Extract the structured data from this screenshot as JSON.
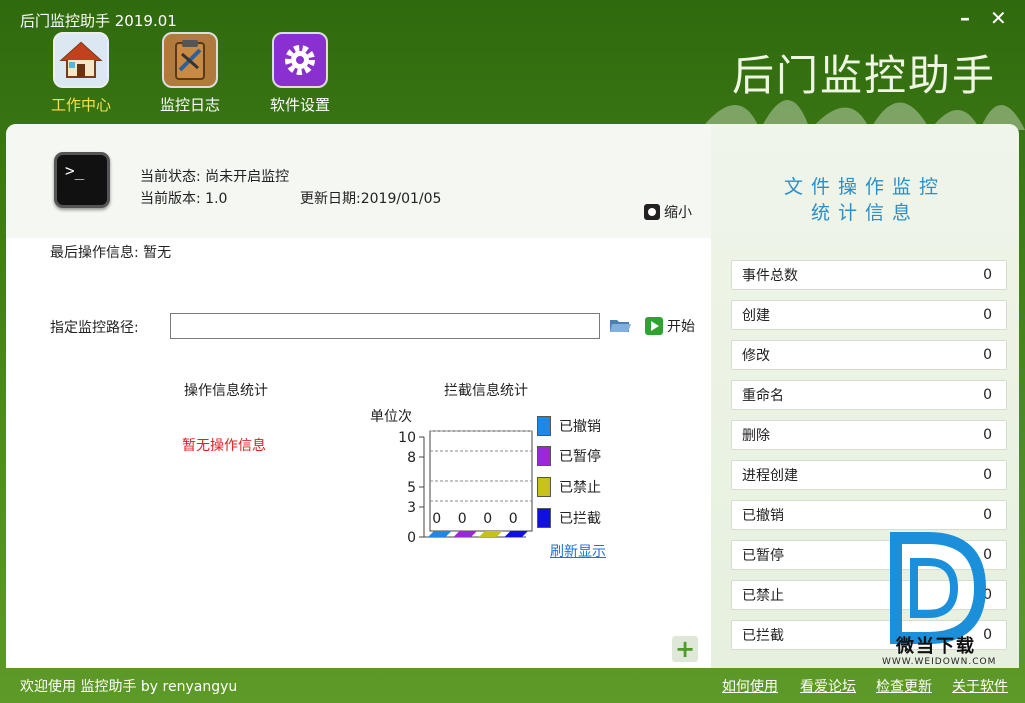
{
  "window": {
    "title": "后门监控助手 2019.01",
    "minimize_label": "–",
    "close_label": "✕"
  },
  "nav": {
    "items": [
      {
        "label": "工作中心",
        "icon": "home-icon",
        "active": true
      },
      {
        "label": "监控日志",
        "icon": "clipboard-log-icon",
        "active": false
      },
      {
        "label": "软件设置",
        "icon": "gear-icon",
        "active": false
      }
    ]
  },
  "brand": {
    "title": "后门监控助手"
  },
  "status": {
    "state_label": "当前状态:",
    "state_value": "尚未开启监控",
    "version_label": "当前版本:",
    "version_value": "1.0",
    "update_label": "更新日期:",
    "update_value": "2019/01/05",
    "shrink_label": "缩小",
    "last_op_label": "最后操作信息:",
    "last_op_value": "暂无"
  },
  "monitor": {
    "path_label": "指定监控路径:",
    "path_value": "",
    "start_label": "开始"
  },
  "stats": {
    "op_title": "操作信息统计",
    "op_empty": "暂无操作信息",
    "block_title": "拦截信息统计",
    "unit_label": "单位次",
    "refresh_label": "刷新显示"
  },
  "chart_data": {
    "type": "bar",
    "title": "拦截信息统计",
    "ylabel": "单位次",
    "ylim": [
      0,
      10
    ],
    "yticks": [
      "10",
      "8",
      "5",
      "3",
      "0"
    ],
    "grid": true,
    "legend_position": "right",
    "series": [
      {
        "name": "已撤销",
        "values": [
          0
        ],
        "color": "#1e88e5"
      },
      {
        "name": "已暂停",
        "values": [
          0
        ],
        "color": "#9c27d9"
      },
      {
        "name": "已禁止",
        "values": [
          0
        ],
        "color": "#c7c21a"
      },
      {
        "name": "已拦截",
        "values": [
          0
        ],
        "color": "#1010e0"
      }
    ],
    "data_labels": [
      "0",
      "0",
      "0",
      "0"
    ]
  },
  "side": {
    "heading_line1": "文件操作监控",
    "heading_line2": "统计信息",
    "rows": [
      {
        "label": "事件总数",
        "value": "0"
      },
      {
        "label": "创建",
        "value": "0"
      },
      {
        "label": "修改",
        "value": "0"
      },
      {
        "label": "重命名",
        "value": "0"
      },
      {
        "label": "删除",
        "value": "0"
      },
      {
        "label": "进程创建",
        "value": "0"
      },
      {
        "label": "已撤销",
        "value": "0"
      },
      {
        "label": "已暂停",
        "value": "0"
      },
      {
        "label": "已禁止",
        "value": "0"
      },
      {
        "label": "已拦截",
        "value": "0"
      }
    ]
  },
  "watermark": {
    "name": "微当下载",
    "url": "WWW.WEIDOWN.COM"
  },
  "footer": {
    "welcome": "欢迎使用 监控助手  by  renyangyu",
    "links": [
      "如何使用",
      "看爱论坛",
      "检查更新",
      "关于软件"
    ]
  },
  "colors": {
    "header_green": "#3f7d17",
    "accent_yellow": "#f2e24a",
    "side_heading": "#2a8fcb",
    "empty_red": "#e02020"
  }
}
